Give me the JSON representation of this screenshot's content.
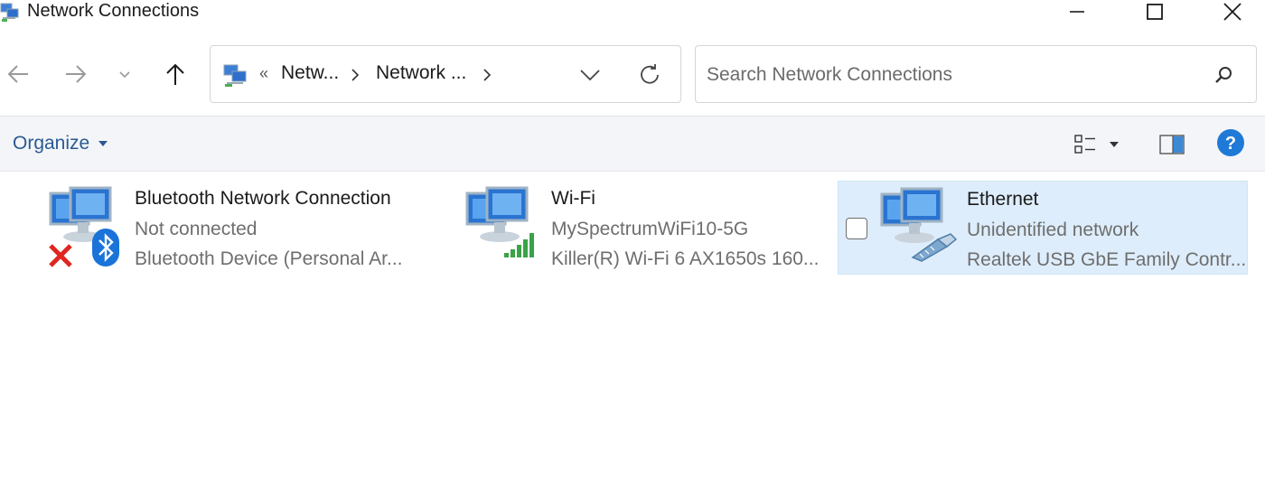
{
  "window": {
    "title": "Network Connections",
    "controls": {
      "minimize": "minimize",
      "maximize": "maximize",
      "close": "close"
    }
  },
  "navigation": {
    "back": "arrow-left-icon",
    "forward": "arrow-right-icon",
    "recent": "chevron-down-icon",
    "up": "arrow-up-icon"
  },
  "address": {
    "overflow": "«",
    "crumbs": [
      "Netw...",
      "Network ..."
    ]
  },
  "search": {
    "placeholder": "Search Network Connections",
    "value": ""
  },
  "commandbar": {
    "organize": "Organize"
  },
  "connections": [
    {
      "name": "Bluetooth Network Connection",
      "status": "Not connected",
      "device": "Bluetooth Device (Personal Ar...",
      "selected": false
    },
    {
      "name": "Wi-Fi",
      "status": "MySpectrumWiFi10-5G",
      "device": "Killer(R) Wi-Fi 6 AX1650s 160...",
      "selected": false
    },
    {
      "name": "Ethernet",
      "status": "Unidentified network",
      "device": "Realtek USB GbE Family Contr...",
      "selected": true
    }
  ],
  "colors": {
    "accent_blue": "#2a5a92",
    "selection_bg": "#deedfb",
    "command_bar_bg": "#f3f5f8",
    "wifi_green": "#3aa346",
    "error_red": "#e0261f",
    "bluetooth_blue": "#1a73d9",
    "help_blue": "#1e7ad6"
  }
}
